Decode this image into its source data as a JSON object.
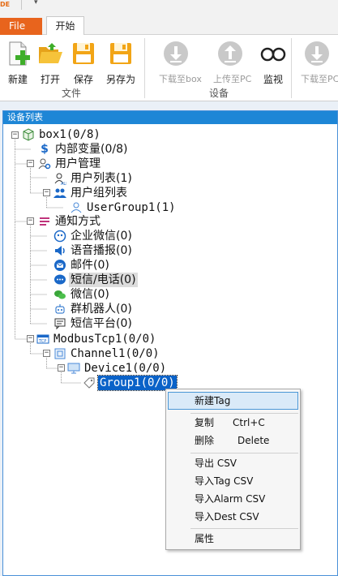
{
  "app": {
    "mark": "DE"
  },
  "tabs": {
    "file": "File",
    "home": "开始"
  },
  "ribbon": {
    "buttons": {
      "new": "新建",
      "open": "打开",
      "save": "保存",
      "save_as": "另存为",
      "download_box": "下载至box",
      "upload_pc": "上传至PC",
      "monitor": "监视",
      "download_pc": "下载至PC"
    },
    "groups": {
      "file": "文件",
      "device": "设备"
    }
  },
  "panel": {
    "title": "设备列表"
  },
  "tree": {
    "box": "box1(0/8)",
    "internal_vars": "内部变量(0/8)",
    "user_mgmt": "用户管理",
    "user_list": "用户列表(1)",
    "user_group_list": "用户组列表",
    "user_group1": "UserGroup1(1)",
    "notify": "通知方式",
    "wecom": "企业微信(0)",
    "voice": "语音播报(0)",
    "email": "邮件(0)",
    "sms_phone": "短信/电话(0)",
    "wechat": "微信(0)",
    "robot": "群机器人(0)",
    "sms_platform": "短信平台(0)",
    "modbus": "ModbusTcp1(0/0)",
    "channel": "Channel1(0/0)",
    "device": "Device1(0/0)",
    "group": "Group1(0/0)"
  },
  "context_menu": {
    "new_tag": "新建Tag",
    "copy": "复制",
    "copy_shortcut": "Ctrl+C",
    "delete": "删除",
    "delete_shortcut": "Delete",
    "export_csv": "导出 CSV",
    "import_tag_csv": "导入Tag CSV",
    "import_alarm_csv": "导入Alarm CSV",
    "import_dest_csv": "导入Dest CSV",
    "properties": "属性"
  },
  "colors": {
    "accent": "#1e86d6",
    "file_tab": "#e8641d",
    "selection": "#0a62c8"
  }
}
